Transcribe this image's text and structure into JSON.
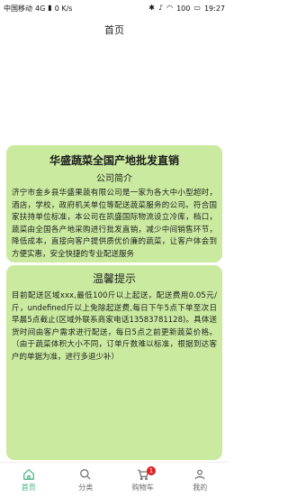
{
  "status_bar": {
    "carrier": "中国移动",
    "network": "4G",
    "speed": "0 K/s",
    "battery": "100",
    "time": "19:27"
  },
  "nav": {
    "title": "首页"
  },
  "intro_card": {
    "title": "华盛蔬菜全国产地批发直销",
    "subtitle": "公司简介",
    "body": "济宁市金乡县华盛果蔬有限公司是一家为各大中小型超时，酒店，学校，政府机关单位等配送蔬菜服务的公司。符合国家扶持单位标准，本公司在凯盛国际物流设立冷库，档口，蔬菜由全国各产地采购进行批发直销，减少中间销售环节，降低成本，直接向客户提供质优价廉的蔬菜，让客户体会到方便实惠，安全快捷的专业配送服务"
  },
  "notice_card": {
    "title": "温馨提示",
    "body": "目前配送区域xxx,最低100斤以上起送，配送费用0.05元/斤，undefined斤以上免除起送费,每日下午5点下单至次日早晨5点截止(区域外联系商家电话13583781128)。具体送货时间由客户需求进行配送，每日5点之前更新蔬菜价格。（由于蔬菜体积大小不同，订单斤数难以标准，根据到达客户的单据为准，进行多退少补）"
  },
  "tabbar": {
    "items": [
      {
        "label": "首页",
        "icon": "home-icon"
      },
      {
        "label": "分类",
        "icon": "search-icon"
      },
      {
        "label": "购物车",
        "icon": "cart-icon",
        "badge": "1"
      },
      {
        "label": "我的",
        "icon": "user-icon"
      }
    ]
  },
  "colors": {
    "card_bg": "#c9ea9f",
    "accent": "#3cb07a",
    "badge": "#e02020"
  }
}
